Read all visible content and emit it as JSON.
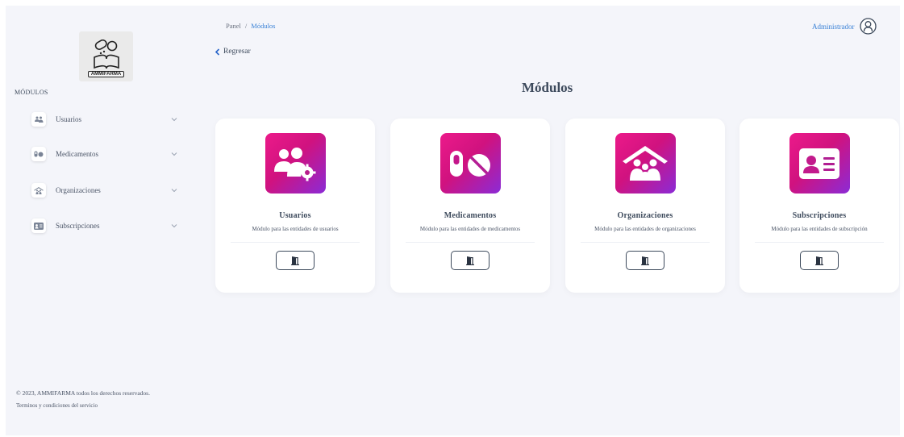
{
  "sidebar": {
    "logo_text": "AMMIFARMA",
    "section_title": "MÓDULOS",
    "items": [
      {
        "label": "Usuarios",
        "icon": "users-icon"
      },
      {
        "label": "Medicamentos",
        "icon": "pills-icon"
      },
      {
        "label": "Organizaciones",
        "icon": "organization-icon"
      },
      {
        "label": "Subscripciones",
        "icon": "id-card-icon"
      }
    ],
    "footer": {
      "copyright": "© 2023, AMMIFARMA todos los derechos reservados.",
      "terms_link": "Terminos y condiciones del servicio"
    }
  },
  "header": {
    "breadcrumb": {
      "root": "Panel",
      "separator": "/",
      "current": "Módulos"
    },
    "back_label": "Regresar",
    "user_name": "Administrador"
  },
  "main": {
    "title": "Módulos",
    "cards": [
      {
        "title": "Usuarios",
        "description": "Módulo para las entidades de usuarios",
        "icon": "users-gear-icon"
      },
      {
        "title": "Medicamentos",
        "description": "Módulo para las entidades de medicamentos",
        "icon": "pills-icon"
      },
      {
        "title": "Organizaciones",
        "description": "Módulo para las entidades de organizaciones",
        "icon": "organization-house-icon"
      },
      {
        "title": "Subscripciones",
        "description": "Módulo para las entidades de subscripción",
        "icon": "id-card-icon"
      }
    ]
  },
  "colors": {
    "accent": "#3b82d6",
    "gradient_start": "#ec1a8a",
    "gradient_end": "#8b2bd6",
    "background": "#f4f5fa",
    "text": "#3d4a5c"
  }
}
